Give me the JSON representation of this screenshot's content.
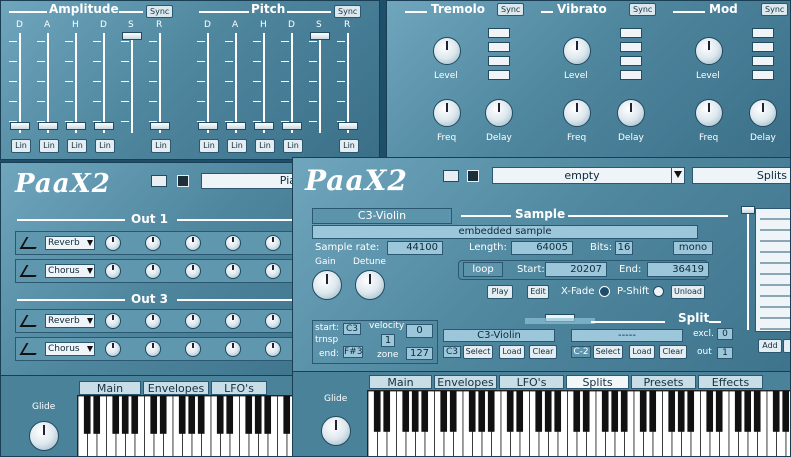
{
  "amplitude": {
    "title": "Amplitude",
    "sync": "Sync",
    "letters": [
      "D",
      "A",
      "H",
      "D",
      "S",
      "R"
    ],
    "lin": "Lin"
  },
  "pitch": {
    "title": "Pitch",
    "sync": "Sync",
    "letters": [
      "D",
      "A",
      "H",
      "D",
      "S",
      "R"
    ],
    "lin": "Lin"
  },
  "tremolo": {
    "title": "Tremolo",
    "sync": "Sync",
    "level": "Level",
    "freq": "Freq",
    "delay": "Delay"
  },
  "vibrato": {
    "title": "Vibrato",
    "sync": "Sync",
    "level": "Level",
    "freq": "Freq",
    "delay": "Delay"
  },
  "mod": {
    "title": "Mod",
    "sync": "Sync",
    "level": "Level",
    "freq": "Freq",
    "delay": "Delay"
  },
  "back": {
    "preset": "Pia",
    "out1": "Out 1",
    "out3": "Out 3",
    "rows": [
      {
        "effect": "Reverb"
      },
      {
        "effect": "Chorus"
      },
      {
        "effect": "Reverb"
      },
      {
        "effect": "Chorus"
      }
    ],
    "glide": "Glide",
    "tabs": [
      "Main",
      "Envelopes",
      "LFO's"
    ]
  },
  "front": {
    "preset": "empty",
    "splits_label": "Splits",
    "sample_name": "C3-Violin",
    "sample_title": "Sample",
    "embedded": "embedded sample",
    "sample_rate_label": "Sample rate:",
    "sample_rate": "44100",
    "length_label": "Length:",
    "length": "64005",
    "bits_label": "Bits:",
    "bits": "16",
    "mono": "mono",
    "gain": "Gain",
    "detune": "Detune",
    "loop": "loop",
    "start_label": "Start:",
    "start": "20207",
    "end_label": "End:",
    "end": "36419",
    "play": "Play",
    "edit": "Edit",
    "xfade": "X-Fade",
    "pshift": "P-Shift",
    "unload": "Unload",
    "split_title": "Split",
    "split_start_label": "start:",
    "split_start": "C3",
    "trnsp": "trnsp",
    "split_end_label": "end:",
    "split_end": "F#3",
    "velocity": "velocity",
    "vel_value": "0",
    "vel_one": "1",
    "zone": "zone",
    "zone_value": "127",
    "slot1_name": "C3-Violin",
    "slot1_note": "C3",
    "slot2_name": "-----",
    "slot2_note": "C-2",
    "select": "Select",
    "load": "Load",
    "clear": "Clear",
    "excl": "excl.",
    "excl_value": "0",
    "out": "out",
    "out_value": "1",
    "add": "Add",
    "glide": "Glide",
    "tabs": [
      "Main",
      "Envelopes",
      "LFO's",
      "Splits",
      "Presets",
      "Effects"
    ],
    "active_tab": "Splits"
  }
}
